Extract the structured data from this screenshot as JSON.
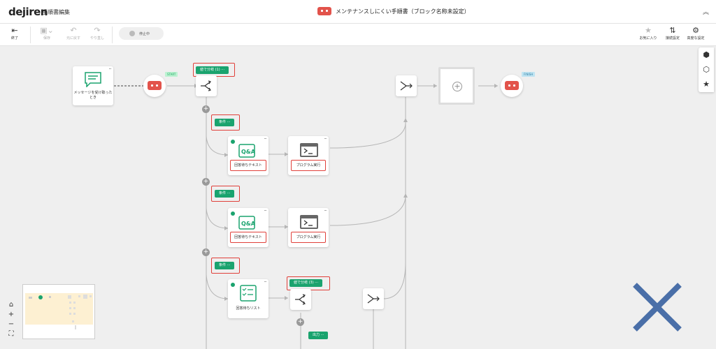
{
  "header": {
    "logo": "dejiren",
    "page_title": "手順書編集",
    "document_title": "メンテナンスしにくい手順書（ブロック名称未設定）",
    "collapse_icon": "chevrons-up-icon"
  },
  "toolbar": {
    "exit": "終了",
    "save": "保存",
    "undo": "元に戻す",
    "redo": "やり直し",
    "status": "停止中",
    "favorite": "お気に入り",
    "connection": "接続設定",
    "advanced": "高度な設定"
  },
  "flow": {
    "trigger_label": "メッセージを受け取ったとき",
    "start_flag": "START",
    "finish_flag": "FINISH",
    "branch1_tag": "値で分岐 (1)",
    "branch3_tag": "値で分岐 (3)",
    "condition_tag": "条件",
    "output_tag": "出力",
    "qa_label": "回答待ちテキスト",
    "program_label": "プログラム実行",
    "list_label": "回答待ちリスト",
    "more": "···"
  },
  "colors": {
    "accent_green": "#1aa36e",
    "bot_red": "#e2534b",
    "highlight_red": "#e0403a",
    "overlay_x": "#4a6fa8"
  }
}
